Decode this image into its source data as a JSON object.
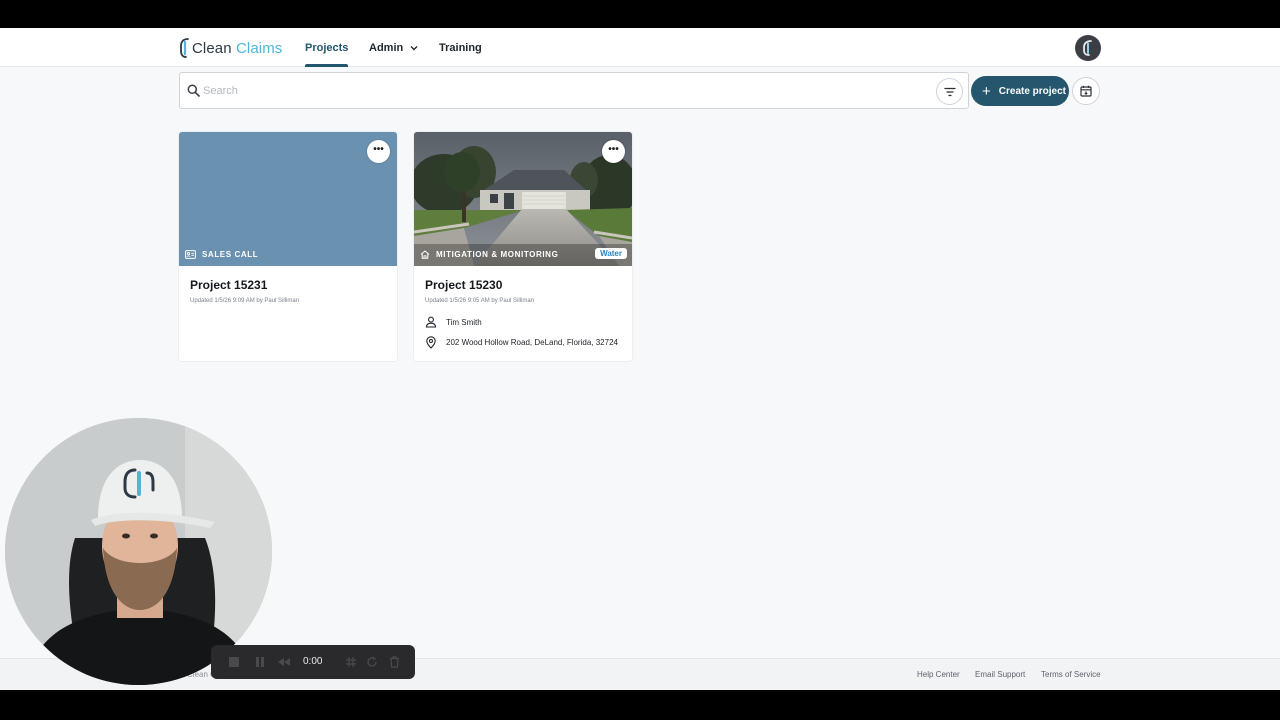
{
  "brand": {
    "name_part1": "Clean",
    "name_part2": " Claims"
  },
  "nav": {
    "tabs": [
      {
        "label": "Projects",
        "active": true
      },
      {
        "label": "Admin",
        "has_dropdown": true
      },
      {
        "label": "Training"
      }
    ]
  },
  "toolbar": {
    "search_placeholder": "Search",
    "search_value": "",
    "create_label": "Create project"
  },
  "projects": [
    {
      "title": "Project 15231",
      "updated": "Updated 1/5/26 9:09 AM by Paul Silliman",
      "category": "SALES CALL",
      "category_icon": "id-card-icon",
      "image": "solid-blue-placeholder"
    },
    {
      "title": "Project 15230",
      "updated": "Updated 1/5/26 9:05 AM by Paul Silliman",
      "category": "MITIGATION & MONITORING",
      "category_icon": "house-icon",
      "badge": "Water",
      "image": "house-photo",
      "contact": "Tim Smith",
      "address": "202 Wood Hollow Road, DeLand, Florida, 32724"
    }
  ],
  "footer": {
    "copyright": "Clean Claims",
    "links": [
      "Help Center",
      "Email Support",
      "Terms of Service"
    ]
  },
  "recorder": {
    "time": "0:00"
  },
  "colors": {
    "accent": "#25566e",
    "brand_light": "#4fb6d8",
    "card_placeholder": "#6a92b0",
    "water_badge": "#2a86c5"
  }
}
